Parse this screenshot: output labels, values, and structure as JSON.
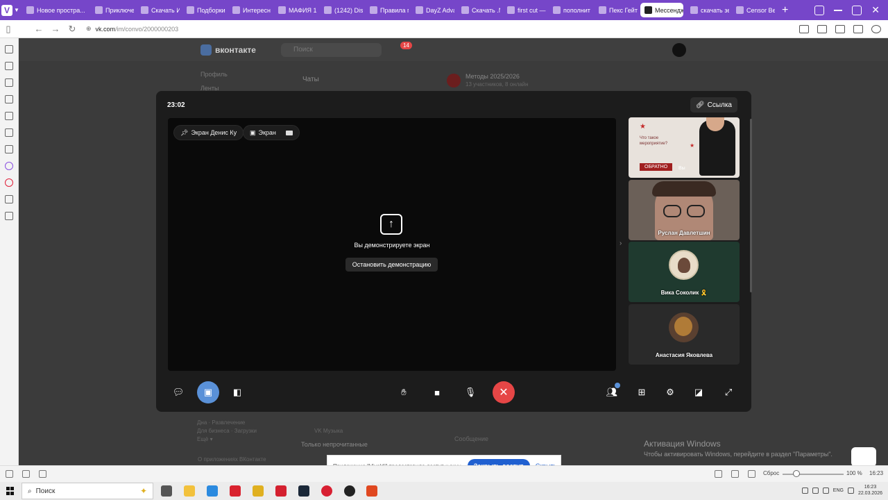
{
  "browser": {
    "tabs": [
      {
        "label": "Новое простра...",
        "active": false
      },
      {
        "label": "Приключе",
        "active": false
      },
      {
        "label": "Скачать И",
        "active": false
      },
      {
        "label": "Подборки",
        "active": false
      },
      {
        "label": "Интересн",
        "active": false
      },
      {
        "label": "МАФИЯ 1",
        "active": false
      },
      {
        "label": "(1242) Disc",
        "active": false
      },
      {
        "label": "Правила п",
        "active": false
      },
      {
        "label": "DayZ Adva",
        "active": false
      },
      {
        "label": "Скачать .N",
        "active": false
      },
      {
        "label": "first cut —",
        "active": false
      },
      {
        "label": "пополнит",
        "active": false
      },
      {
        "label": "Пекс Гейт",
        "active": false
      },
      {
        "label": "Мессендж",
        "active": true
      },
      {
        "label": "скачать зе",
        "active": false
      },
      {
        "label": "Censor Bes",
        "active": false
      }
    ],
    "url_host": "vk.com",
    "url_path": "/im/convo/2000000203"
  },
  "vk": {
    "logo_text": "вконтакте",
    "search_placeholder": "Поиск",
    "notifications_count": "14",
    "menu": [
      "Профиль",
      "Ленты"
    ],
    "chats_title": "Чаты",
    "convo_title": "Методы 2025/2026",
    "convo_subtitle": "13 участников, 8 онлайн",
    "lower_items": [
      "VK Музыка",
      "Дна · Развлечение",
      "Для бизнеса · Загрузки",
      "Ещё ▾"
    ],
    "unread_toggle_label": "Только непрочитанные",
    "message_placeholder": "Сообщение",
    "footer_link": "О приложениях ВКонтакте"
  },
  "call": {
    "timer": "23:02",
    "link_label": "Ссылка",
    "chip_pinned": "Экран Денис Ку",
    "chip_screen": "Экран",
    "share_message": "Вы демонстрируете экран",
    "stop_label": "Остановить демонстрацию",
    "participants": [
      {
        "name": "",
        "type": "ad",
        "ad_title": "Что такое мероприятие?",
        "ad_button": "ОБРАТНО",
        "ad_extra": "Вы"
      },
      {
        "name": "Руслан Давлетшин",
        "type": "video"
      },
      {
        "name": "Вика Соколик 🎗️",
        "type": "avatar"
      },
      {
        "name": "Анастасия Яковлева",
        "type": "avatar"
      }
    ]
  },
  "notice": {
    "text": "Приложение \"Vivaldi\" предоставило доступ к окну.",
    "stop_label": "Закрыть доступ",
    "hide_label": "Скрыть"
  },
  "activation": {
    "title": "Активация Windows",
    "subtitle": "Чтобы активировать Windows, перейдите в раздел \"Параметры\"."
  },
  "statusbar": {
    "reset_label": "Сброс",
    "zoom": "100 %",
    "clock": "16:23"
  },
  "taskbar": {
    "search_placeholder": "Поиск",
    "lang": "ENG",
    "time": "16:23",
    "date": "22.03.2026"
  },
  "colors": {
    "tabbar": "#7646c9",
    "end_call": "#e64646",
    "screen_btn": "#5a91d8",
    "notice_button": "#2060d0"
  }
}
